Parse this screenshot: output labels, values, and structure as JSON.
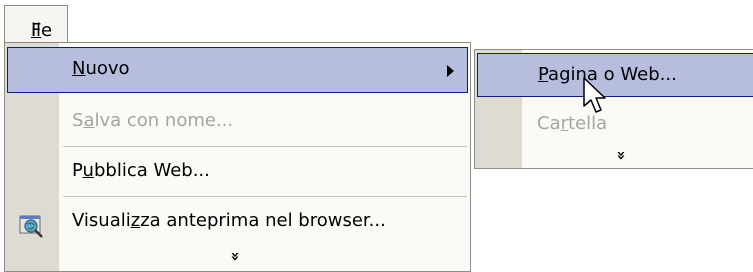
{
  "menubar": {
    "file": {
      "pre": "",
      "key": "F",
      "post": "ile"
    }
  },
  "menu": {
    "items": [
      {
        "pre": "",
        "key": "N",
        "post": "uovo",
        "state": "highlighted",
        "has_submenu": true
      },
      {
        "pre": "S",
        "key": "a",
        "post": "lva con nome...",
        "state": "disabled"
      },
      {
        "pre": "P",
        "key": "u",
        "post": "bblica Web...",
        "state": "enabled"
      },
      {
        "pre": "Visuali",
        "key": "z",
        "post": "za anteprima nel browser...",
        "state": "enabled",
        "icon": "browser-preview-icon"
      }
    ],
    "expand_glyph": "»"
  },
  "submenu": {
    "items": [
      {
        "pre": "",
        "key": "P",
        "post": "agina o Web...",
        "state": "highlighted"
      },
      {
        "pre": "Ca",
        "key": "r",
        "post": "tella",
        "state": "disabled"
      }
    ],
    "expand_glyph": "»"
  },
  "colors": {
    "highlight_fill": "#b7bddd",
    "highlight_border": "#0a1e84",
    "menu_bg": "#fbfaf6",
    "gutter": "#dedbd3",
    "disabled_text": "#a6a49e"
  }
}
